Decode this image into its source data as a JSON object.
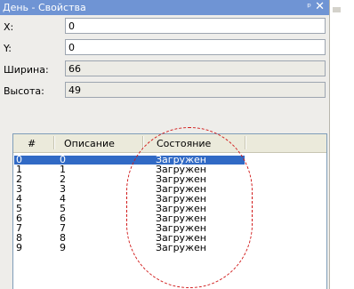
{
  "window": {
    "title": "День - Свойства",
    "pin_symbol": "ᵖ",
    "close_symbol": "✕"
  },
  "properties": [
    {
      "label": "X:",
      "value": "0",
      "editable": true
    },
    {
      "label": "Y:",
      "value": "0",
      "editable": true
    },
    {
      "label": "Ширина:",
      "value": "66",
      "editable": false
    },
    {
      "label": "Высота:",
      "value": "49",
      "editable": false
    }
  ],
  "list": {
    "columns": [
      "#",
      "Описание",
      "Состояние"
    ],
    "rows": [
      {
        "num": "0",
        "desc": "0",
        "state": "Загружен",
        "selected": true
      },
      {
        "num": "1",
        "desc": "1",
        "state": "Загружен"
      },
      {
        "num": "2",
        "desc": "2",
        "state": "Загружен"
      },
      {
        "num": "3",
        "desc": "3",
        "state": "Загружен"
      },
      {
        "num": "4",
        "desc": "4",
        "state": "Загружен"
      },
      {
        "num": "5",
        "desc": "5",
        "state": "Загружен"
      },
      {
        "num": "6",
        "desc": "6",
        "state": "Загружен"
      },
      {
        "num": "7",
        "desc": "7",
        "state": "Загружен"
      },
      {
        "num": "8",
        "desc": "8",
        "state": "Загружен"
      },
      {
        "num": "9",
        "desc": "9",
        "state": "Загружен"
      }
    ]
  },
  "colors": {
    "title_bar": "#6f94d4",
    "selection": "#316ac5",
    "annotation": "#d11a1a"
  }
}
